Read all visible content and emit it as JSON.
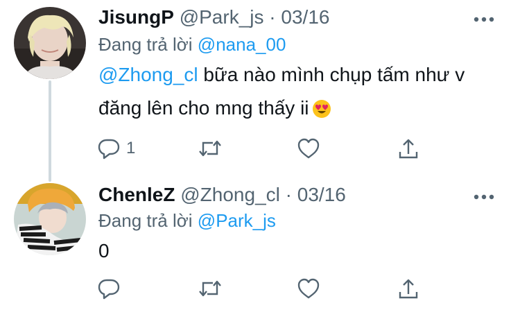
{
  "tweets": [
    {
      "display_name": "JisungP",
      "handle": "@Park_js",
      "separator": "·",
      "date": "03/16",
      "replying_prefix": "Đang trả lời",
      "replying_to": "@nana_00",
      "mention": "@Zhong_cl",
      "text_line1": " bữa nào mình chụp tấm như v",
      "text_line2": "đăng lên cho mng thấy ii",
      "emoji_icon": "heart-eyes-emoji-icon",
      "reply_count": "1",
      "actions": [
        "reply-icon",
        "retweet-icon",
        "like-icon",
        "share-icon"
      ]
    },
    {
      "display_name": "ChenleZ",
      "handle": "@Zhong_cl",
      "separator": "·",
      "date": "03/16",
      "replying_prefix": "Đang trả lời",
      "replying_to": "@Park_js",
      "text_line1": "0",
      "actions": [
        "reply-icon",
        "retweet-icon",
        "like-icon",
        "share-icon"
      ]
    }
  ],
  "colors": {
    "link": "#1d9bf0",
    "secondary_text": "#536471",
    "primary_text": "#0f1419",
    "thread_line": "#cfd9de"
  }
}
